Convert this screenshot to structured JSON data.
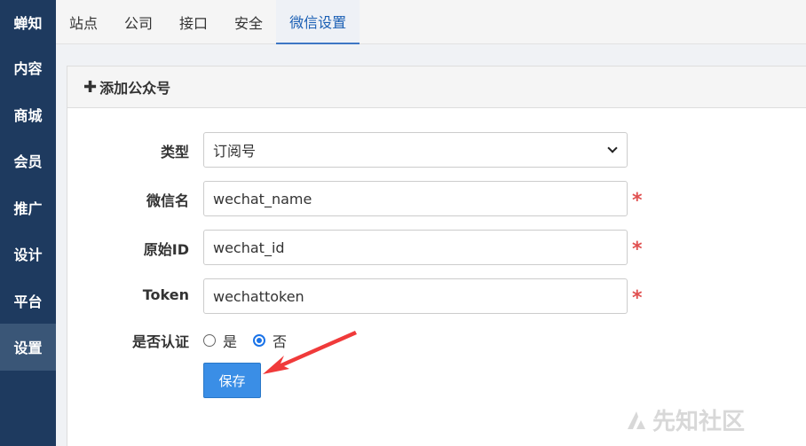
{
  "sidebar": {
    "brand": "蝉知",
    "items": [
      {
        "label": "内容"
      },
      {
        "label": "商城"
      },
      {
        "label": "会员"
      },
      {
        "label": "推广"
      },
      {
        "label": "设计"
      },
      {
        "label": "平台"
      },
      {
        "label": "设置",
        "active": true
      }
    ]
  },
  "topbar": {
    "tabs": [
      {
        "label": "站点"
      },
      {
        "label": "公司"
      },
      {
        "label": "接口"
      },
      {
        "label": "安全"
      },
      {
        "label": "微信设置",
        "active": true
      }
    ]
  },
  "panel": {
    "title": "添加公众号",
    "plus_glyph": "✚"
  },
  "form": {
    "type": {
      "label": "类型",
      "value": "订阅号"
    },
    "wechat_name": {
      "label": "微信名",
      "value": "wechat_name",
      "required_mark": "*"
    },
    "original_id": {
      "label": "原始ID",
      "value": "wechat_id",
      "required_mark": "*"
    },
    "token": {
      "label": "Token",
      "value": "wechattoken",
      "required_mark": "*"
    },
    "certified": {
      "label": "是否认证",
      "options": [
        "是",
        "否"
      ],
      "selected": "否"
    },
    "save_label": "保存"
  },
  "watermark": {
    "text": "先知社区"
  },
  "colors": {
    "sidebar_bg": "#1e3a5f",
    "accent": "#3a8ee6",
    "required": "#e05050",
    "arrow": "#f03a3a"
  }
}
